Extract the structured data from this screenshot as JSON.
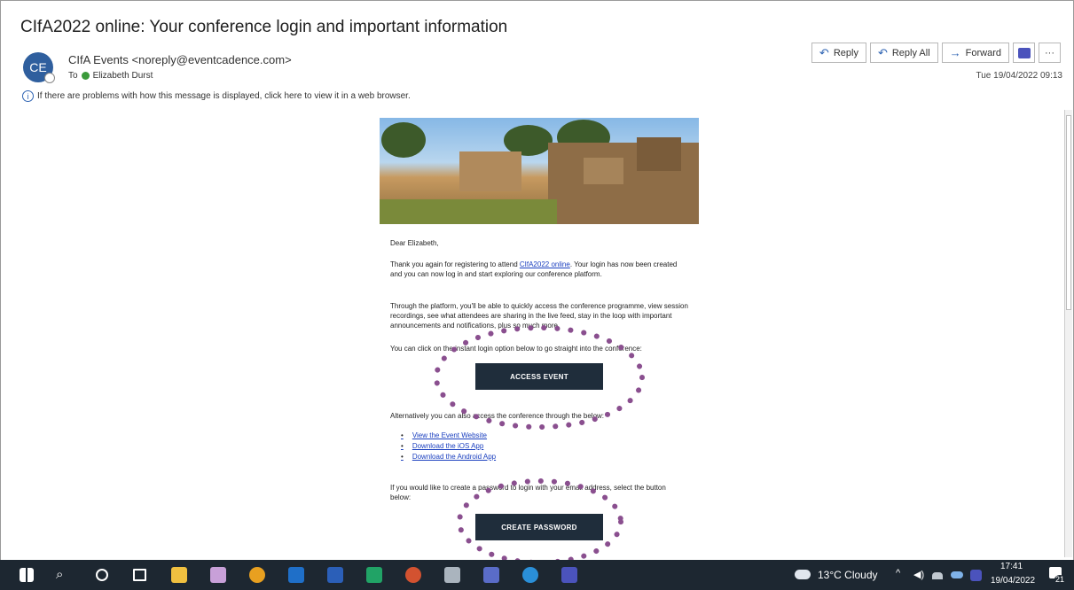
{
  "email": {
    "subject": "CIfA2022 online: Your conference login and important information",
    "avatar_initials": "CE",
    "sender": "CIfA Events <noreply@eventcadence.com>",
    "to_label": "To",
    "recipient": "Elizabeth Durst",
    "info_message": "If there are problems with how this message is displayed, click here to view it in a web browser.",
    "date": "Tue 19/04/2022 09:13"
  },
  "actions": {
    "reply": "Reply",
    "reply_all": "Reply All",
    "forward": "Forward",
    "more": "···"
  },
  "body": {
    "greeting": "Dear Elizabeth,",
    "p1_before": "Thank you again for registering to attend ",
    "p1_link": "CIfA2022 online",
    "p1_after": ". Your login has now been created and you can now log in and start exploring our conference platform.",
    "p2": "Through the platform, you'll be able to quickly access the conference programme, view session recordings, see what attendees are sharing in the live feed, stay in the loop with important announcements and notifications, plus so much more.",
    "p3": "You can click on the instant login option below to go straight into the conference:",
    "access_button": "ACCESS EVENT",
    "p4": "Alternatively you can also access the conference through the below:",
    "links": [
      "View the Event Website",
      "Download the iOS App",
      "Download the Android App"
    ],
    "p5": "If you would like to create a password to login with your email address, select the button below:",
    "password_button": "CREATE PASSWORD"
  },
  "annotation_color": "#8a4f8f",
  "taskbar": {
    "weather": "13°C Cloudy",
    "time": "17:41",
    "date": "19/04/2022",
    "notifications": "21"
  }
}
